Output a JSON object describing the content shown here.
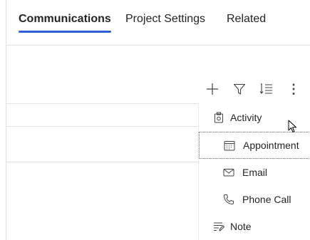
{
  "tabs": [
    {
      "label": "Communications",
      "active": true
    },
    {
      "label": "Project Settings",
      "active": false
    },
    {
      "label": "Related",
      "active": false
    }
  ],
  "toolbar": {
    "add_icon": "plus-icon",
    "filter_icon": "filter-icon",
    "sort_icon": "sort-icon",
    "more_icon": "more-vertical-icon",
    "more_label": "⋮"
  },
  "menu": {
    "items": [
      {
        "label": "Activity",
        "icon": "activity-icon"
      },
      {
        "label": "Appointment",
        "icon": "calendar-icon"
      },
      {
        "label": "Email",
        "icon": "mail-icon"
      },
      {
        "label": "Phone Call",
        "icon": "phone-icon"
      },
      {
        "label": "Note",
        "icon": "note-icon"
      }
    ]
  },
  "colors": {
    "accent": "#2f5fd8",
    "text": "#242424",
    "divider": "#e1e1e1"
  }
}
